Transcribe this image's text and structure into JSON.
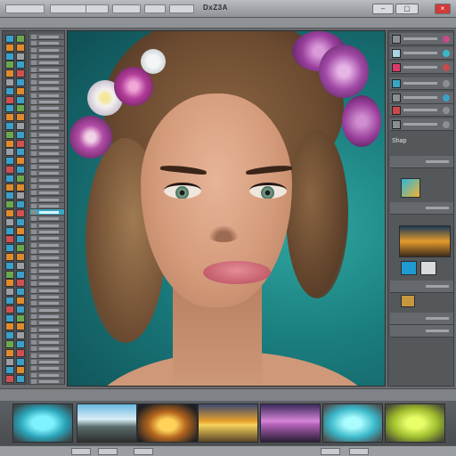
{
  "window": {
    "title": "DxZ3A",
    "controls": {
      "minimize": "–",
      "maximize": "▢",
      "close": "×"
    }
  },
  "menu": {
    "items": [
      "",
      "",
      "",
      "",
      "",
      "",
      ""
    ]
  },
  "right_panel": {
    "labels": [
      "Shap"
    ]
  },
  "colors": {
    "accent": "#39a7c4",
    "panel_bg": "#55585b",
    "canvas_teal": "#1b7f7f"
  },
  "filmstrip": {
    "thumbnails": [
      "teal-glow",
      "beach-scene",
      "sunset-golden",
      "sunset-amber",
      "purple-dusk",
      "cyan-glow",
      "lime-glow"
    ]
  }
}
